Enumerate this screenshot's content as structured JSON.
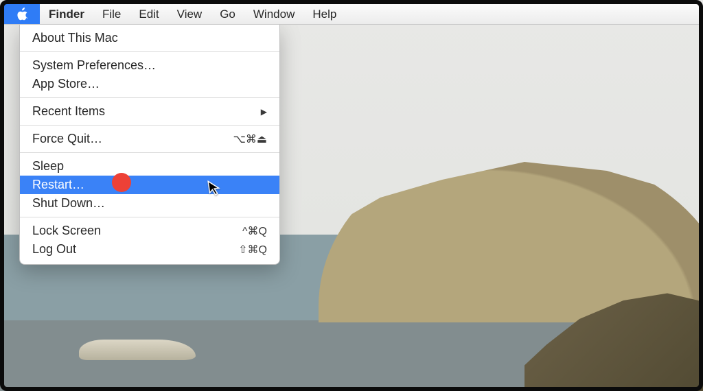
{
  "menubar": {
    "app": "Finder",
    "items": [
      "File",
      "Edit",
      "View",
      "Go",
      "Window",
      "Help"
    ]
  },
  "appleMenu": {
    "about": "About This Mac",
    "sysprefs": "System Preferences…",
    "appstore": "App Store…",
    "recent": "Recent Items",
    "forcequit": "Force Quit…",
    "forcequit_sc": "⌥⌘⏏",
    "sleep": "Sleep",
    "restart": "Restart…",
    "shutdown": "Shut Down…",
    "lock": "Lock Screen",
    "lock_sc": "^⌘Q",
    "logout": "Log Out",
    "logout_sc": "⇧⌘Q"
  },
  "arrow": "▶"
}
